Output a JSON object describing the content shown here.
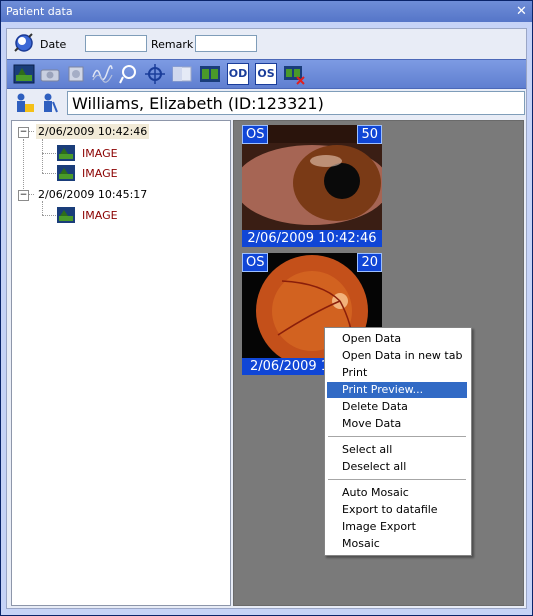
{
  "window": {
    "title": "Patient data"
  },
  "search": {
    "date_label": "Date",
    "date_value": "",
    "remark_label": "Remark",
    "remark_value": ""
  },
  "toolbar": {
    "buttons": [
      "image-view-icon",
      "camera-icon",
      "scan-icon",
      "waveform-icon",
      "probe-icon",
      "target-icon",
      "layout-icon",
      "film-icon",
      "od-button",
      "os-button",
      "delete-film-icon"
    ],
    "od_label": "OD",
    "os_label": "OS"
  },
  "patient": {
    "name_id": "Williams, Elizabeth  (ID:123321)"
  },
  "tree": {
    "sessions": [
      {
        "date": "2/06/2009 10:42:46",
        "items": [
          "IMAGE",
          "IMAGE"
        ]
      },
      {
        "date": "2/06/2009 10:45:17",
        "items": [
          "IMAGE"
        ]
      }
    ]
  },
  "thumbnails": [
    {
      "eye": "OS",
      "number": "50",
      "date": "2/06/2009 10:42:46",
      "type": "anterior-eye"
    },
    {
      "eye": "OS",
      "number": "20",
      "date": "2/06/2009 1",
      "type": "fundus"
    }
  ],
  "context_menu": {
    "items": [
      "Open Data",
      "Open Data in new tab",
      "Print",
      "Print Preview...",
      "Delete Data",
      "Move Data",
      "Select all",
      "Deselect all",
      "Auto Mosaic",
      "Export to datafile",
      "Image Export",
      "Mosaic"
    ],
    "highlighted": "Print Preview..."
  },
  "colors": {
    "title_bg": "#5f7fd0",
    "badge_bg": "#1046d6",
    "highlight": "#316ac5",
    "image_item": "#8b0000"
  }
}
